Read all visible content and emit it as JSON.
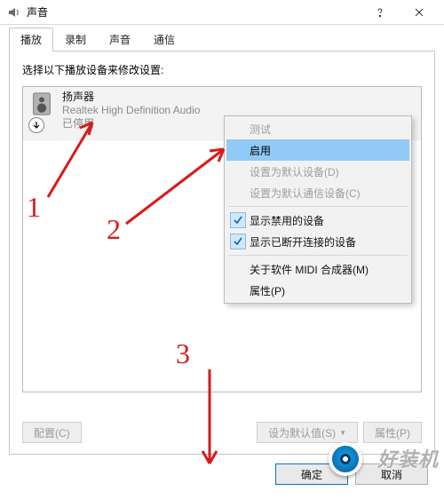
{
  "window": {
    "title": "声音"
  },
  "tabs": [
    {
      "label": "播放",
      "active": true
    },
    {
      "label": "录制",
      "active": false
    },
    {
      "label": "声音",
      "active": false
    },
    {
      "label": "通信",
      "active": false
    }
  ],
  "panel": {
    "instruction": "选择以下播放设备来修改设置:",
    "device": {
      "name": "扬声器",
      "driver": "Realtek High Definition Audio",
      "status": "已停用"
    },
    "configure_btn": "配置(C)",
    "set_default_btn": "设为默认值(S)",
    "default_dropdown_glyph": "▼",
    "properties_btn": "属性(P)"
  },
  "context_menu": {
    "items": [
      {
        "label": "测试",
        "state": "disabled"
      },
      {
        "label": "启用",
        "state": "highlight"
      },
      {
        "label": "设置为默认设备(D)",
        "state": "disabled"
      },
      {
        "label": "设置为默认通信设备(C)",
        "state": "disabled"
      },
      {
        "sep": true
      },
      {
        "label": "显示禁用的设备",
        "state": "checked"
      },
      {
        "label": "显示已断开连接的设备",
        "state": "checked"
      },
      {
        "sep": true
      },
      {
        "label": "关于软件 MIDI 合成器(M)",
        "state": "normal"
      },
      {
        "label": "属性(P)",
        "state": "normal"
      }
    ]
  },
  "dialog_buttons": {
    "ok": "确定",
    "cancel": "取消"
  },
  "annotations": {
    "n1": "1",
    "n2": "2",
    "n3": "3"
  },
  "watermark": {
    "text": "好装机"
  }
}
